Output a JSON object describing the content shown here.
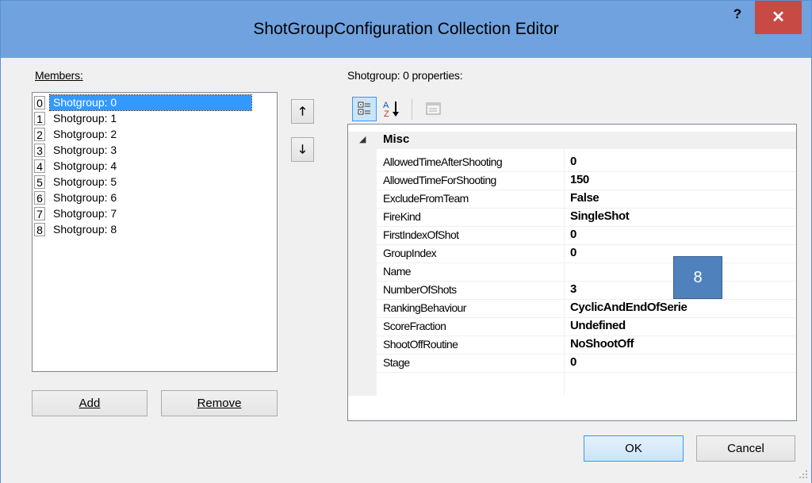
{
  "window": {
    "title": "ShotGroupConfiguration Collection Editor",
    "help_label": "?",
    "close_label": "✕"
  },
  "members": {
    "label": "Members:",
    "items": [
      {
        "index": "0",
        "label": "Shotgroup:  0",
        "selected": true
      },
      {
        "index": "1",
        "label": "Shotgroup:  1"
      },
      {
        "index": "2",
        "label": "Shotgroup:  2"
      },
      {
        "index": "3",
        "label": "Shotgroup:  3"
      },
      {
        "index": "4",
        "label": "Shotgroup:  4"
      },
      {
        "index": "5",
        "label": "Shotgroup:  5"
      },
      {
        "index": "6",
        "label": "Shotgroup:  6"
      },
      {
        "index": "7",
        "label": "Shotgroup:  7"
      },
      {
        "index": "8",
        "label": "Shotgroup:  8"
      }
    ],
    "move_up_label": "🡑",
    "move_down_label": "🡓",
    "add_label": "Add",
    "remove_label": "Remove"
  },
  "properties": {
    "label": "Shotgroup:  0 properties:",
    "toolbar": {
      "categorized_icon": "categorized-icon",
      "alphabetical_icon": "alphabetical-sort-icon",
      "property_pages_icon": "property-pages-icon"
    },
    "category": "Misc",
    "rows": [
      {
        "name": "AllowedTimeAfterShooting",
        "value": "0"
      },
      {
        "name": "AllowedTimeForShooting",
        "value": "150"
      },
      {
        "name": "ExcludeFromTeam",
        "value": "False"
      },
      {
        "name": "FireKind",
        "value": "SingleShot"
      },
      {
        "name": "FirstIndexOfShot",
        "value": "0"
      },
      {
        "name": "GroupIndex",
        "value": "0"
      },
      {
        "name": "Name",
        "value": ""
      },
      {
        "name": "NumberOfShots",
        "value": "3"
      },
      {
        "name": "RankingBehaviour",
        "value": "CyclicAndEndOfSerie"
      },
      {
        "name": "ScoreFraction",
        "value": "Undefined"
      },
      {
        "name": "ShootOffRoutine",
        "value": "NoShootOff"
      },
      {
        "name": "Stage",
        "value": "0"
      }
    ]
  },
  "badge_label": "8",
  "footer": {
    "ok_label": "OK",
    "cancel_label": "Cancel"
  }
}
